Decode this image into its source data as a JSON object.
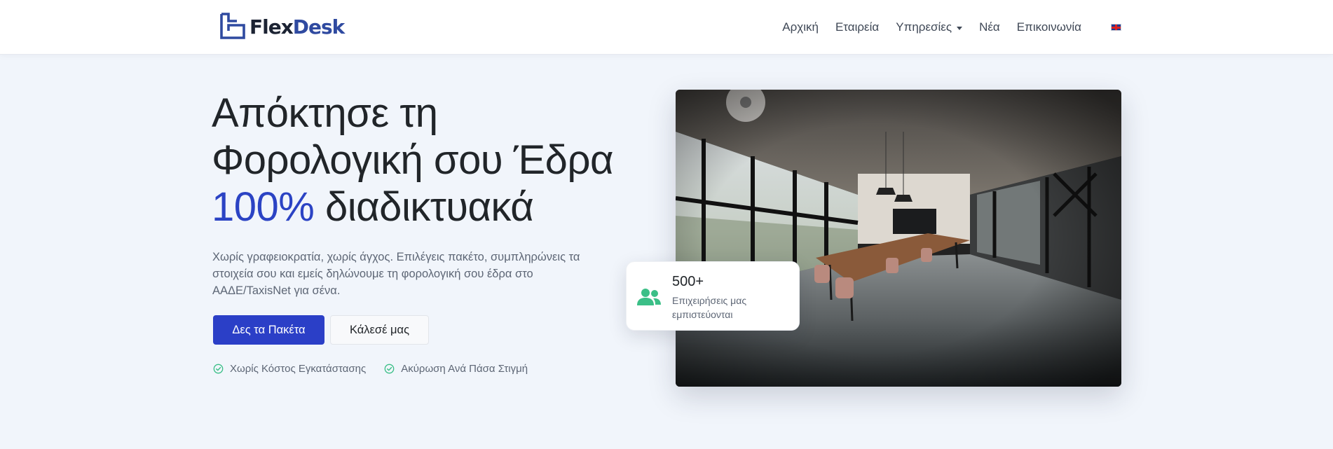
{
  "brand": {
    "name_part1": "Flex",
    "name_part2": "Desk",
    "colors": {
      "dark": "#1c2333",
      "blue": "#2f4aa0"
    }
  },
  "nav": {
    "items": [
      {
        "label": "Αρχική"
      },
      {
        "label": "Εταιρεία"
      },
      {
        "label": "Υπηρεσίες",
        "has_dropdown": true
      },
      {
        "label": "Νέα"
      },
      {
        "label": "Επικοινωνία"
      }
    ],
    "language_icon": "uk-flag-icon"
  },
  "hero": {
    "title_line1": "Απόκτησε τη",
    "title_line2": "Φορολογική σου Έδρα",
    "title_accent": "100%",
    "title_line3_rest": " διαδικτυακά",
    "description": "Χωρίς γραφειοκρατία, χωρίς άγχος. Επιλέγεις πακέτο, συμπληρώνεις τα στοιχεία σου και εμείς δηλώνουμε τη φορολογική σου έδρα στο ΑΑΔΕ/TaxisNet για σένα.",
    "primary_button": "Δες τα Πακέτα",
    "secondary_button": "Κάλεσέ μας",
    "features": [
      {
        "label": "Χωρίς Κόστος Εγκατάστασης",
        "icon": "check-circle-icon"
      },
      {
        "label": "Ακύρωση Ανά Πάσα Στιγμή",
        "icon": "check-circle-icon"
      }
    ]
  },
  "stat": {
    "number": "500+",
    "label": "Επιχειρήσεις μας εμπιστεύονται",
    "icon": "users-icon"
  },
  "colors": {
    "accent": "#2b43c4",
    "primary_button": "#2b3fc7",
    "success": "#3bbf87",
    "background": "#f1f5fb"
  }
}
